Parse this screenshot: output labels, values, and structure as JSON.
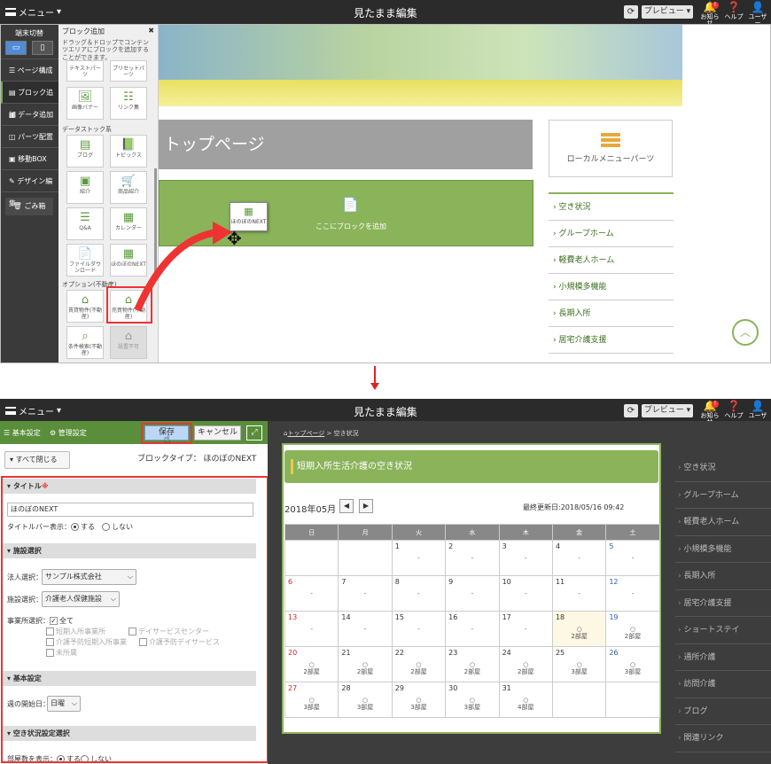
{
  "topbar": {
    "menu": "メニュー",
    "title": "見たまま編集",
    "preview": "プレビュー",
    "notice": "お知らせ",
    "help": "ヘルプ",
    "user": "ユーザー",
    "badge": "!"
  },
  "top_sidebar": {
    "device_header": "端末切替",
    "items": [
      "ページ構成",
      "ブロック追加",
      "データ追加",
      "パーツ配置",
      "移動BOX",
      "デザイン編集",
      "ごみ箱"
    ]
  },
  "block_panel": {
    "title": "ブロック追加",
    "desc": "ドラッグ＆ドロップでコンテンツエリアにブロックを追加することができます。",
    "tiles_top": [
      "テキストパーツ",
      "プリセットパーツ",
      "画像バナー",
      "リンク集"
    ],
    "datastock_label": "データストック系",
    "tiles_data": [
      "ブログ",
      "トピックス",
      "紹介",
      "商品紹介",
      "Q&A",
      "カレンダー",
      "ファイルダウンロード",
      "ほのぼのNEXT"
    ],
    "option_label": "オプション(不動産)",
    "tiles_opt": [
      "賃貸物件(不動産)",
      "売買物件(不動産)",
      "条件検索(不動産)",
      "設置不可"
    ]
  },
  "preview_top": {
    "page_title": "トップページ",
    "add_block": "ここにブロックを追加",
    "drag_tile": "ほのぼのNEXT",
    "local_menu": "ローカルメニューパーツ",
    "nav": [
      "空き状況",
      "グループホーム",
      "軽費老人ホーム",
      "小規模多機能",
      "長期入所",
      "居宅介護支援"
    ]
  },
  "editor": {
    "tab_basic": "基本設定",
    "tab_admin": "管理設定",
    "save": "保存",
    "cancel": "キャンセル",
    "close_all": "すべて閉じる",
    "block_type": "ブロックタイプ： ほのぼのNEXT",
    "sec_title": "タイトル",
    "required": "※",
    "title_value": "ほのぼのNEXT",
    "titlebar_label": "タイトルバー表示：",
    "yes": "する",
    "no": "しない",
    "sec_facility": "施設選択",
    "corp_label": "法人選択：",
    "corp_value": "サンプル株式会社",
    "facility_label": "施設選択：",
    "facility_value": "介護老人保健施設",
    "office_label": "事業所選択：",
    "office_all": "全て",
    "office_opts": [
      "短期入所事業所",
      "デイサービスセンター",
      "介護予防短期入所事業",
      "介護予防デイサービス",
      "未所属"
    ],
    "sec_basic": "基本設定",
    "week_label": "週の開始日：",
    "week_value": "日曜",
    "sec_vacancy": "空き状況設定選択",
    "rooms_label": "部屋数を表示："
  },
  "preview_bottom": {
    "breadcrumb_home": "トップページ",
    "breadcrumb_sep": " > ",
    "breadcrumb_current": "空き状況",
    "card_title": "短期入所生活介護の空き状況",
    "month": "2018年05月",
    "updated": "最終更新日:2018/05/16 09:42",
    "weekdays": [
      "日",
      "月",
      "火",
      "水",
      "木",
      "金",
      "土"
    ],
    "nav": [
      "空き状況",
      "グループホーム",
      "軽費老人ホーム",
      "小規模多機能",
      "長期入所",
      "居宅介護支援",
      "ショートステイ",
      "通所介護",
      "訪問介護",
      "ブログ",
      "関連リンク"
    ]
  },
  "calendar": [
    [
      [
        "",
        ""
      ],
      [
        "",
        ""
      ],
      [
        "1",
        "-"
      ],
      [
        "2",
        "-"
      ],
      [
        "3",
        "-"
      ],
      [
        "4",
        "-"
      ],
      [
        "5",
        "-"
      ]
    ],
    [
      [
        "6",
        "-"
      ],
      [
        "7",
        "-"
      ],
      [
        "8",
        "-"
      ],
      [
        "9",
        "-"
      ],
      [
        "10",
        "-"
      ],
      [
        "11",
        "-"
      ],
      [
        "12",
        "-"
      ]
    ],
    [
      [
        "13",
        "-"
      ],
      [
        "14",
        "-"
      ],
      [
        "15",
        "-"
      ],
      [
        "16",
        "-"
      ],
      [
        "17",
        "-"
      ],
      [
        "18",
        "○\n2部屋"
      ],
      [
        "19",
        "○\n2部屋"
      ]
    ],
    [
      [
        "20",
        "○\n2部屋"
      ],
      [
        "21",
        "○\n2部屋"
      ],
      [
        "22",
        "○\n2部屋"
      ],
      [
        "23",
        "○\n2部屋"
      ],
      [
        "24",
        "○\n2部屋"
      ],
      [
        "25",
        "○\n3部屋"
      ],
      [
        "26",
        "○\n3部屋"
      ]
    ],
    [
      [
        "27",
        "○\n3部屋"
      ],
      [
        "28",
        "○\n3部屋"
      ],
      [
        "29",
        "○\n3部屋"
      ],
      [
        "30",
        "○\n3部屋"
      ],
      [
        "31",
        "○\n4部屋"
      ],
      [
        "",
        ""
      ],
      [
        "",
        ""
      ]
    ]
  ]
}
